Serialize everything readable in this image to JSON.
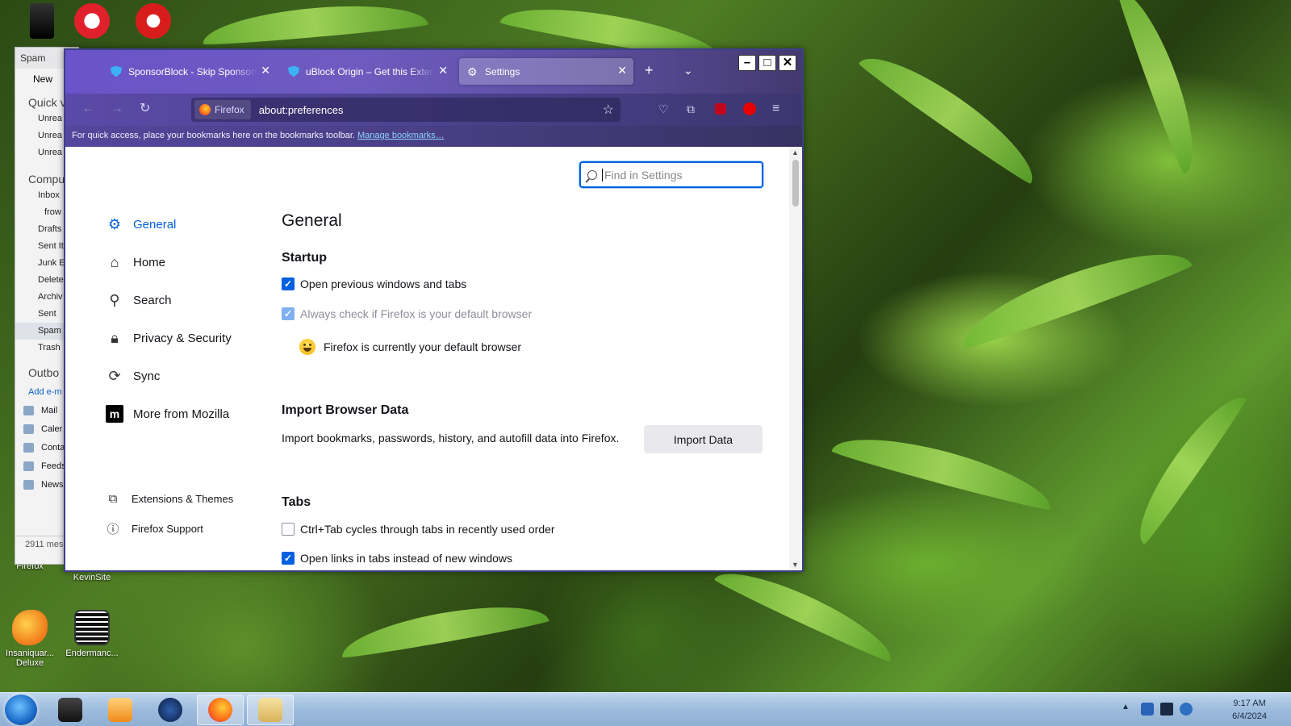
{
  "desktop": {
    "icons": [
      {
        "label": "Firefox"
      },
      {
        "label": "KevinSite"
      },
      {
        "label": "Insaniquar... Deluxe"
      },
      {
        "label": "Endermanc..."
      }
    ]
  },
  "thunderbird": {
    "title": "Spam",
    "new_label": "New",
    "quick_label": "Quick v",
    "unread": [
      "Unrea",
      "Unrea",
      "Unrea"
    ],
    "computer_label": "Compu",
    "folders": [
      "Inbox",
      "frow",
      "Drafts",
      "Sent It",
      "Junk E",
      "Delete",
      "Archiv",
      "Sent",
      "Spam",
      "Trash"
    ],
    "outbox_label": "Outbo",
    "add_email": "Add e-m",
    "apps": [
      "Mail",
      "Caler",
      "Conta",
      "Feeds",
      "News"
    ],
    "status": "2911 mes"
  },
  "browser": {
    "tabs": [
      {
        "label": "SponsorBlock - Skip Sponsorships on YouTube"
      },
      {
        "label": "uBlock Origin – Get this Extension"
      },
      {
        "label": "Settings"
      }
    ],
    "identity_label": "Firefox",
    "url": "about:preferences",
    "bookmarks_hint": "For quick access, place your bookmarks here on the bookmarks toolbar.",
    "manage_bookmarks": "Manage bookmarks…"
  },
  "settings": {
    "search_placeholder": "Find in Settings",
    "nav": [
      {
        "label": "General",
        "icon": "gear-icon"
      },
      {
        "label": "Home",
        "icon": "home-icon"
      },
      {
        "label": "Search",
        "icon": "search-icon"
      },
      {
        "label": "Privacy & Security",
        "icon": "lock-icon"
      },
      {
        "label": "Sync",
        "icon": "sync-icon"
      },
      {
        "label": "More from Mozilla",
        "icon": "mozilla-icon"
      }
    ],
    "footer_nav": [
      {
        "label": "Extensions & Themes",
        "icon": "puzzle-icon"
      },
      {
        "label": "Firefox Support",
        "icon": "help-icon"
      }
    ],
    "page_title": "General",
    "startup": {
      "heading": "Startup",
      "open_previous": "Open previous windows and tabs",
      "always_check": "Always check if Firefox is your default browser",
      "default_status": "Firefox is currently your default browser"
    },
    "import": {
      "heading": "Import Browser Data",
      "description": "Import bookmarks, passwords, history, and autofill data into Firefox.",
      "button": "Import Data"
    },
    "tabs": {
      "heading": "Tabs",
      "ctrl_tab": "Ctrl+Tab cycles through tabs in recently used order",
      "open_links": "Open links in tabs instead of new windows"
    }
  },
  "taskbar": {
    "time": "9:17 AM",
    "date": "6/4/2024"
  },
  "colors": {
    "accent": "#0061e0",
    "toolbar": "#5b4aa8"
  }
}
